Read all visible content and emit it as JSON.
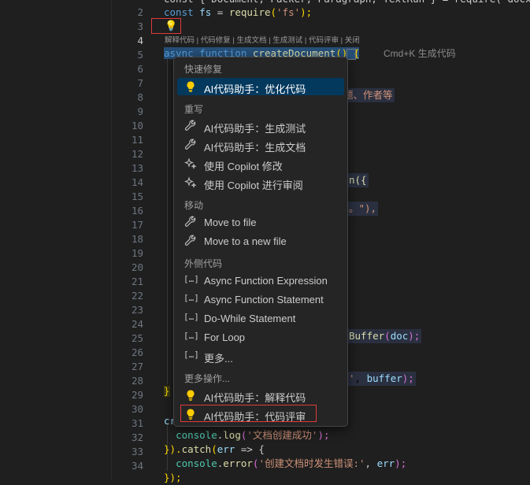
{
  "editor": {
    "line_numbers": [
      "2",
      "3",
      "4",
      "5",
      "6",
      "7",
      "8",
      "9",
      "10",
      "11",
      "12",
      "13",
      "14",
      "15",
      "16",
      "17",
      "18",
      "19",
      "20",
      "21",
      "22",
      "23",
      "24",
      "25",
      "26",
      "27",
      "28",
      "29",
      "30",
      "31",
      "32",
      "33",
      "34"
    ],
    "line1_partial": "const { Document, Packer, Paragraph, TextRun } = require('docx');",
    "line2": {
      "kw": "const",
      "var": "fs",
      "op": " = ",
      "fn": "require",
      "str": "'fs'",
      "end": ");"
    },
    "line4": {
      "kw": "async function",
      "fn": "createDocument",
      "paren": "()",
      "brace": "{"
    },
    "codelens": "解释代码 | 代码修复 | 生成文档 | 生成测试 | 代码评审 | 关闭",
    "cmdk_hint": "Cmd+K 生成代码",
    "frag_l7": "题、作者等",
    "frag_l13": "n({",
    "frag_l15": "。\"),",
    "frag_l24_fn": "Buffer",
    "frag_l24_arg": "doc",
    "frag_l24_end": ");",
    "frag_l27_str": "'",
    "frag_l27_var": "buffer",
    "frag_l27_end": ");",
    "line28": "}",
    "line30": "cr",
    "line31": {
      "obj": "console",
      "fn": "log",
      "str": "'文档创建成功'",
      "end": ");"
    },
    "line32": {
      "open": "}).",
      "fn": "catch",
      "paren": "(",
      "var": "err",
      "arrow": " => {"
    },
    "line33": {
      "obj": "console",
      "fn": "error",
      "str": "'创建文档时发生错误:'",
      "var": "err",
      "end": ");"
    },
    "line34": "});"
  },
  "menu": {
    "sections": {
      "quick_fix": "快速修复",
      "rewrite": "重写",
      "move": "移动",
      "surround": "外侧代码",
      "more_actions": "更多操作..."
    },
    "items": {
      "optimize": "AI代码助手：优化代码",
      "gen_test": "AI代码助手：生成测试",
      "gen_doc": "AI代码助手：生成文档",
      "copilot_modify": "使用 Copilot 修改",
      "copilot_review": "使用 Copilot 进行审阅",
      "move_to_file": "Move to file",
      "move_to_new_file": "Move to a new file",
      "async_expr": "Async Function Expression",
      "async_stmt": "Async Function Statement",
      "do_while": "Do-While Statement",
      "for_loop": "For Loop",
      "more": "更多...",
      "explain": "AI代码助手：解释代码",
      "review": "AI代码助手：代码评审"
    },
    "snippet_icon": "[…]",
    "colors": {
      "selected_bg": "#04395e",
      "bulb": "#ffcc00",
      "highlight_box": "#e03b3b"
    }
  }
}
